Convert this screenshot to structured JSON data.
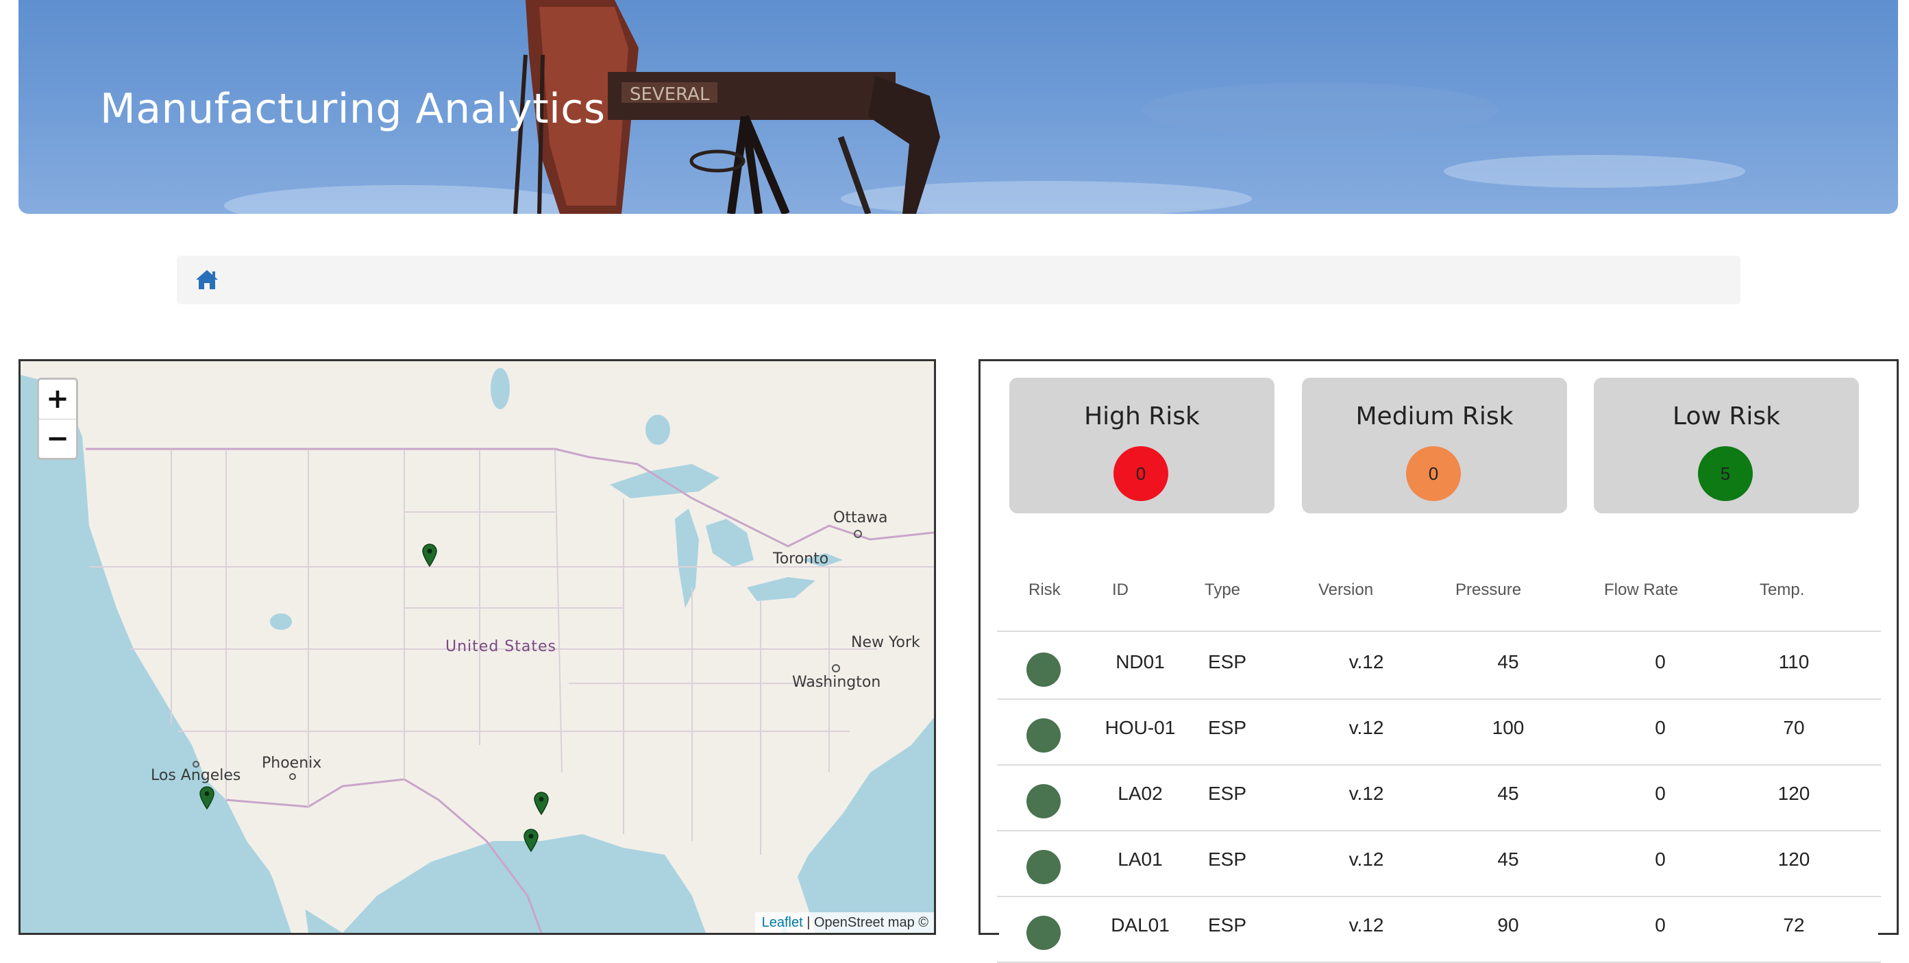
{
  "banner": {
    "title": "Manufacturing Analytics",
    "pump_sign": "SEVERAL"
  },
  "breadcrumb": {
    "home_icon": "home-icon"
  },
  "map": {
    "zoom_in": "+",
    "zoom_out": "−",
    "labels": {
      "ottawa": "Ottawa",
      "toronto": "Toronto",
      "united_states": "United States",
      "new_york": "New York",
      "washington": "Washington",
      "phoenix": "Phoenix",
      "los_angeles": "Los Angeles"
    },
    "attribution_link": "Leaflet",
    "attribution_text": "| OpenStreet map ©",
    "marker_color": "#1e6b2c"
  },
  "risk_summary": {
    "high": {
      "label": "High Risk",
      "count": "0",
      "color": "#f0121e"
    },
    "medium": {
      "label": "Medium Risk",
      "count": "0",
      "color": "#f0894a"
    },
    "low": {
      "label": "Low Risk",
      "count": "5",
      "color": "#0d7a14"
    }
  },
  "table": {
    "headers": {
      "risk": "Risk",
      "id": "ID",
      "type": "Type",
      "version": "Version",
      "pressure": "Pressure",
      "flow_rate": "Flow Rate",
      "temp": "Temp."
    },
    "rows": [
      {
        "id": "ND01",
        "type": "ESP",
        "version": "v.12",
        "pressure": "45",
        "flow_rate": "0",
        "temp": "110"
      },
      {
        "id": "HOU-01",
        "type": "ESP",
        "version": "v.12",
        "pressure": "100",
        "flow_rate": "0",
        "temp": "70"
      },
      {
        "id": "LA02",
        "type": "ESP",
        "version": "v.12",
        "pressure": "45",
        "flow_rate": "0",
        "temp": "120"
      },
      {
        "id": "LA01",
        "type": "ESP",
        "version": "v.12",
        "pressure": "45",
        "flow_rate": "0",
        "temp": "120"
      },
      {
        "id": "DAL01",
        "type": "ESP",
        "version": "v.12",
        "pressure": "90",
        "flow_rate": "0",
        "temp": "72"
      }
    ],
    "risk_dot_color": "#4a7350"
  }
}
